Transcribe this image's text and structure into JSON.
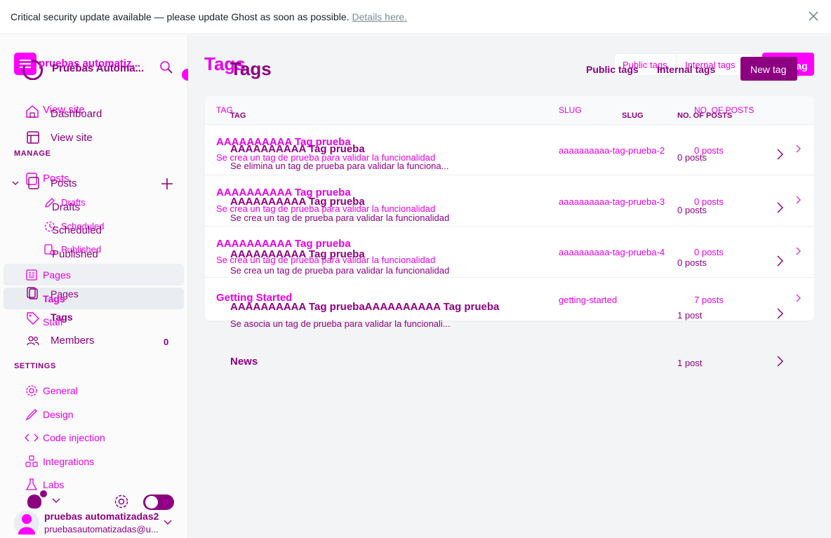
{
  "banner": {
    "text": "Critical security update available — please update Ghost as soon as possible.",
    "link": "Details here."
  },
  "sidebar": {
    "site_title_primary": "pruebas automatiz...",
    "site_title_secondary": "Pruebas Automa...",
    "dashboard_label": "Dashboard",
    "view_site_primary": "View site",
    "view_site_secondary": "View site",
    "manage_label": "MANAGE",
    "posts_primary": "Posts",
    "posts_secondary": "Posts",
    "drafts_primary": "Drafts",
    "drafts_secondary": "Drafts",
    "scheduled_primary": "Scheduled",
    "scheduled_secondary": "Scheduled",
    "published_primary": "Published",
    "published_secondary": "Published",
    "pages_primary": "Pages",
    "pages_secondary": "Pages",
    "tags_primary": "Tags",
    "tags_secondary": "Tags",
    "staff_label": "Staff",
    "members_label": "Members",
    "members_count": "0",
    "settings_label": "SETTINGS",
    "general_label": "General",
    "design_label": "Design",
    "code_injection_label": "Code injection",
    "integrations_label": "Integrations",
    "labs_label": "Labs",
    "user_name": "pruebas automatizadas2",
    "user_email": "pruebasautomatizadas@u..."
  },
  "header": {
    "title_primary": "Tags",
    "title_secondary": "Tags",
    "public_tags_primary": "Public tags",
    "public_tags_secondary": "Public tags",
    "internal_tags_primary": "Internal tags",
    "internal_tags_secondary": "Internal tags",
    "new_tag_primary": "New tag",
    "new_tag_secondary": "New tag"
  },
  "table": {
    "col_tag_primary": "TAG",
    "col_tag_secondary": "TAG",
    "col_slug_primary": "SLUG",
    "col_slug_secondary": "SLUG",
    "col_posts_primary": "NO. OF POSTS",
    "col_posts_secondary": "NO. OF POSTS",
    "rows_primary": [
      {
        "name": "AAAAAAAAAA Tag prueba",
        "desc": "Se crea un tag de prueba para validar la funcionalidad",
        "slug": "aaaaaaaaaa-tag-prueba-2",
        "count": "0 posts"
      },
      {
        "name": "AAAAAAAAAA Tag prueba",
        "desc": "Se crea un tag de prueba para validar la funcionalidad",
        "slug": "aaaaaaaaaa-tag-prueba-3",
        "count": "0 posts"
      },
      {
        "name": "AAAAAAAAAA Tag prueba",
        "desc": "Se crea un tag de prueba para validar la funcionalidad",
        "slug": "aaaaaaaaaa-tag-prueba-4",
        "count": "0 posts"
      },
      {
        "name": "Getting Started",
        "desc": "",
        "slug": "getting-started",
        "count": "7 posts"
      }
    ],
    "rows_secondary": [
      {
        "name": "AAAAAAAAAA Tag prueba",
        "desc": "Se elimina un tag de prueba para validar la funciona...",
        "count": "0 posts"
      },
      {
        "name": "AAAAAAAAAA Tag prueba",
        "desc": "Se crea un tag de prueba para validar la funcionalidad",
        "count": "0 posts"
      },
      {
        "name": "AAAAAAAAAA Tag prueba",
        "desc": "Se crea un tag de prueba para validar la funcionalidad",
        "count": "0 posts"
      },
      {
        "name": "AAAAAAAAAA Tag pruebaAAAAAAAAAA Tag prueba",
        "desc": "Se asocia un tag de prueba para validar la funcionali...",
        "count": "1 post"
      },
      {
        "name": "News",
        "desc": "",
        "count": "1 post"
      }
    ]
  },
  "colors": {
    "magenta": "#e600e6",
    "purple": "#8c0080",
    "accent_button": "#ff00ff"
  }
}
